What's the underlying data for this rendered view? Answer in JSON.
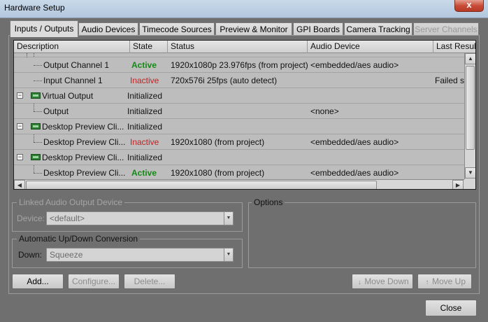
{
  "window": {
    "title": "Hardware Setup",
    "close_glyph": "x"
  },
  "tabs": [
    {
      "label": "Inputs / Outputs",
      "active": true
    },
    {
      "label": "Audio Devices"
    },
    {
      "label": "Timecode Sources"
    },
    {
      "label": "Preview & Monitor"
    },
    {
      "label": "GPI Boards"
    },
    {
      "label": "Camera Tracking"
    },
    {
      "label": "Server Channels",
      "disabled": true
    }
  ],
  "grid": {
    "columns": [
      "Description",
      "State",
      "Status",
      "Audio Device",
      "Last Result"
    ],
    "rows": [
      {
        "desc": "Output Channel 1",
        "state": "Active",
        "status": "1920x1080p 23.976fps (from project)",
        "audio": "<embedded/aes audio>",
        "last": ""
      },
      {
        "desc": "Input Channel 1",
        "state": "Inactive",
        "status": "720x576i 25fps (auto detect)",
        "audio": "",
        "last": "Failed se"
      },
      {
        "desc": "Virtual Output",
        "state": "Initialized",
        "status": "",
        "audio": "",
        "last": ""
      },
      {
        "desc": "Output",
        "state": "Initialized",
        "status": "",
        "audio": "<none>",
        "last": ""
      },
      {
        "desc": "Desktop Preview Cli...",
        "state": "Initialized",
        "status": "",
        "audio": "",
        "last": ""
      },
      {
        "desc": "Desktop Preview Cli...",
        "state": "Inactive",
        "status": "1920x1080 (from project)",
        "audio": "<embedded/aes audio>",
        "last": ""
      },
      {
        "desc": "Desktop Preview Cli...",
        "state": "Initialized",
        "status": "",
        "audio": "",
        "last": ""
      },
      {
        "desc": "Desktop Preview Cli...",
        "state": "Active",
        "status": "1920x1080 (from project)",
        "audio": "<embedded/aes audio>",
        "last": ""
      }
    ]
  },
  "linked_audio": {
    "title": "Linked Audio Output Device",
    "device_label": "Device:",
    "device_value": "<default>"
  },
  "conversion": {
    "title": "Automatic Up/Down Conversion",
    "down_label": "Down:",
    "down_value": "Squeeze"
  },
  "options": {
    "title": "Options"
  },
  "buttons": {
    "add": "Add...",
    "configure": "Configure...",
    "delete": "Delete...",
    "move_down": "Move Down",
    "move_up": "Move Up",
    "close": "Close"
  },
  "colors": {
    "active": "#138a13",
    "inactive": "#c42121",
    "panel_bg": "#6f6f6f"
  }
}
